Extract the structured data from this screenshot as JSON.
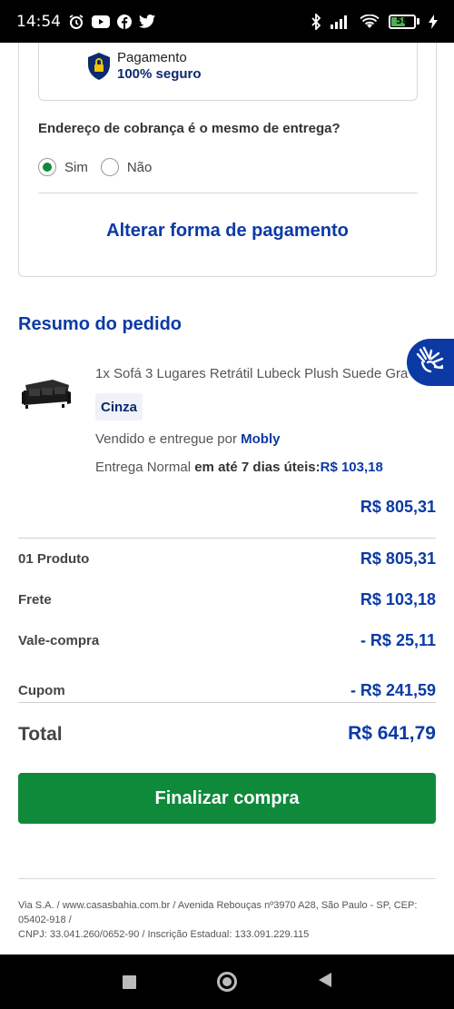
{
  "status_bar": {
    "time": "14:54",
    "battery": "58"
  },
  "payment": {
    "secure_line1": "Pagamento",
    "secure_line2": "100% seguro",
    "billing_question": "Endereço de cobrança é o mesmo de entrega?",
    "options": [
      "Sim",
      "Não"
    ],
    "selected_option": "Sim",
    "change_payment_label": "Alterar forma de pagamento"
  },
  "summary": {
    "title": "Resumo do pedido",
    "product": {
      "name": "1x Sofá 3 Lugares Retrátil Lubeck Plush Suede Gra",
      "color": "Cinza",
      "sold_by_prefix": "Vendido e entregue por ",
      "seller": "Mobly",
      "delivery_prefix": "Entrega Normal ",
      "delivery_time": "em até 7 dias úteis:",
      "delivery_price": "R$ 103,18",
      "item_total": "R$ 805,31"
    },
    "rows": [
      {
        "label": "01 Produto",
        "value": "R$ 805,31"
      },
      {
        "label": "Frete",
        "value": "R$ 103,18"
      },
      {
        "label": "Vale-compra",
        "value": "- R$ 25,11"
      },
      {
        "label": "Cupom",
        "value": "- R$ 241,59"
      }
    ],
    "total_label": "Total",
    "total_value": "R$ 641,79",
    "finalize_label": "Finalizar compra"
  },
  "footer": {
    "line1": "Via S.A. / www.casasbahia.com.br / Avenida Rebouças nº3970 A28, São Paulo - SP, CEP: 05402-918 /",
    "line2": "CNPJ: 33.041.260/0652-90 / Inscrição Estadual: 133.091.229.115"
  },
  "colors": {
    "brand_blue": "#0b3aa5",
    "cta_green": "#0f8a3a"
  }
}
